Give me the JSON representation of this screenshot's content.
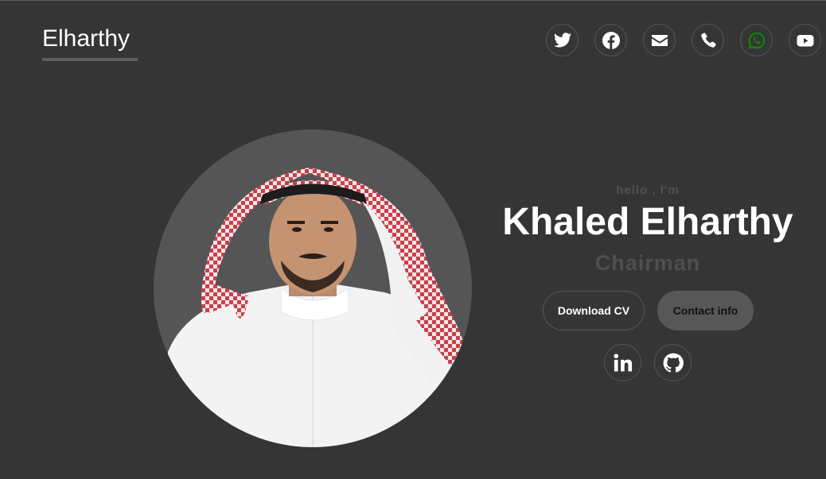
{
  "header": {
    "logo_text": "Elharthy",
    "social_icons": [
      {
        "name": "twitter-icon",
        "color": "#ffffff"
      },
      {
        "name": "facebook-icon",
        "color": "#ffffff"
      },
      {
        "name": "envelope-icon",
        "color": "#ffffff"
      },
      {
        "name": "phone-icon",
        "color": "#ffffff"
      },
      {
        "name": "whatsapp-icon",
        "color": "#0b8a0b"
      },
      {
        "name": "youtube-icon",
        "color": "#ffffff"
      }
    ]
  },
  "hero": {
    "greeting": "hello , I'm",
    "name": "Khaled Elharthy",
    "role": "Chairman",
    "download_label": "Download CV",
    "contact_label": "Contact info",
    "profiles": [
      {
        "name": "linkedin-icon"
      },
      {
        "name": "github-icon"
      }
    ]
  },
  "colors": {
    "background": "#353535",
    "accent_gray": "#575757",
    "whatsapp_green": "#0b8a0b"
  }
}
